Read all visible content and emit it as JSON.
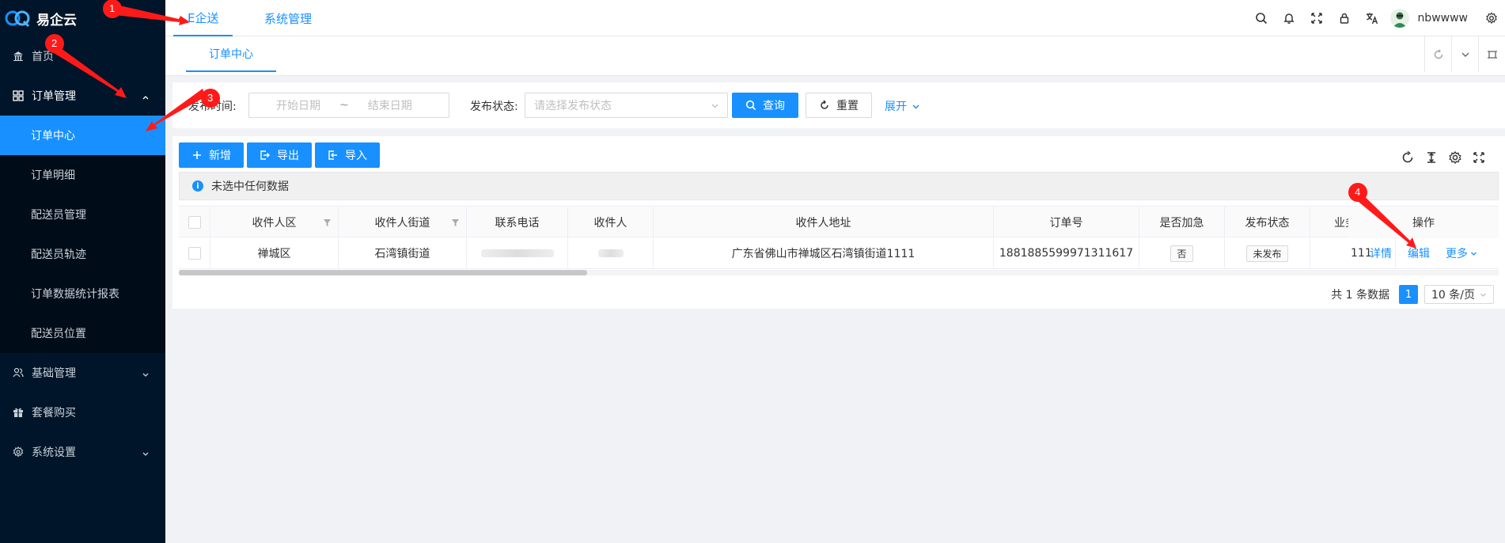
{
  "sidebar": {
    "logo_text": "易企云",
    "items": [
      {
        "label": "首页"
      },
      {
        "label": "订单管理"
      },
      {
        "label": "基础管理"
      },
      {
        "label": "套餐购买"
      },
      {
        "label": "系统设置"
      }
    ],
    "submenu": [
      {
        "label": "订单中心"
      },
      {
        "label": "订单明细"
      },
      {
        "label": "配送员管理"
      },
      {
        "label": "配送员轨迹"
      },
      {
        "label": "订单数据统计报表"
      },
      {
        "label": "配送员位置"
      }
    ]
  },
  "topbar": {
    "tab1": "E企送",
    "tab2": "系统管理",
    "username": "nbwwww"
  },
  "tabsbar": {
    "active_tab": "订单中心"
  },
  "search": {
    "time_label": "发布时间:",
    "start_placeholder": "开始日期",
    "separator": "~",
    "end_placeholder": "结束日期",
    "status_label": "发布状态:",
    "status_placeholder": "请选择发布状态",
    "query_btn": "查询",
    "reset_btn": "重置",
    "expand_link": "展开"
  },
  "toolbar": {
    "add_btn": "新增",
    "export_btn": "导出",
    "import_btn": "导入"
  },
  "alert": {
    "text": "未选中任何数据"
  },
  "table": {
    "headers": [
      "收件人区",
      "收件人街道",
      "联系电话",
      "收件人",
      "收件人地址",
      "订单号",
      "是否加急",
      "发布状态",
      "业务类型",
      "操作"
    ],
    "row": {
      "district": "禅城区",
      "street": "石湾镇街道",
      "address": "广东省佛山市禅城区石湾镇街道1111",
      "order_no": "1881885599971311617",
      "urgent": "否",
      "status": "未发布",
      "biz_type": "111",
      "op_detail": "详情",
      "op_edit": "编辑",
      "op_more": "更多"
    }
  },
  "pagination": {
    "total_text": "共 1 条数据",
    "current_page": "1",
    "page_size": "10 条/页"
  },
  "annotations": [
    "1",
    "2",
    "3",
    "4"
  ],
  "colors": {
    "primary": "#1890ff",
    "sidebar_bg": "#001529",
    "annotation_red": "#ff1a1a"
  }
}
